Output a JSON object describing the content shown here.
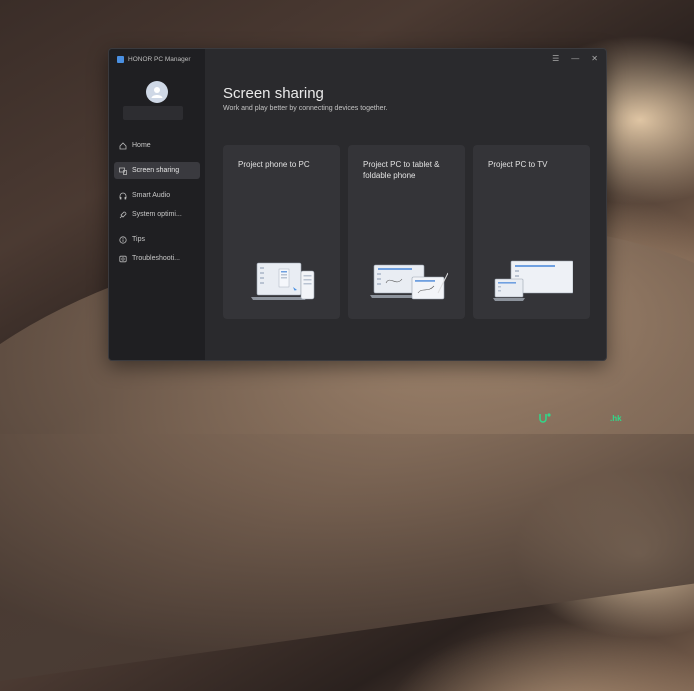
{
  "window": {
    "app_title": "HONOR PC Manager",
    "controls": {
      "menu": "☰",
      "minimize": "—",
      "close": "✕"
    }
  },
  "sidebar": {
    "items": [
      {
        "label": "Home",
        "icon": "home-icon"
      },
      {
        "label": "Screen sharing",
        "icon": "screen-share-icon",
        "active": true
      },
      {
        "label": "Smart Audio",
        "icon": "headphones-icon"
      },
      {
        "label": "System optimi...",
        "icon": "rocket-icon"
      },
      {
        "label": "Tips",
        "icon": "tips-icon"
      },
      {
        "label": "Troubleshooti...",
        "icon": "troubleshoot-icon"
      }
    ]
  },
  "main": {
    "title": "Screen sharing",
    "subtitle": "Work and play better by connecting devices together.",
    "cards": [
      {
        "label": "Project phone to PC"
      },
      {
        "label": "Project PC to tablet & foldable phone"
      },
      {
        "label": "Project PC to TV"
      }
    ]
  },
  "watermark": {
    "text": ".hk"
  },
  "colors": {
    "accent": "#4a90e2",
    "background": "#2a2a2d",
    "sidebar": "#1f1f22",
    "card": "#343438"
  }
}
